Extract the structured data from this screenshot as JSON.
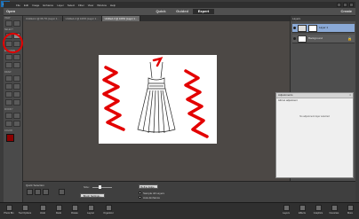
{
  "app": {
    "logo_text": "Ps",
    "menu": [
      "File",
      "Edit",
      "Image",
      "Enhance",
      "Layer",
      "Select",
      "Filter",
      "View",
      "Window",
      "Help"
    ],
    "open_label": "Open",
    "create_label": "Create",
    "modes": [
      "Quick",
      "Guided",
      "Expert"
    ],
    "active_mode": "Expert"
  },
  "document_tabs": [
    {
      "label": "Untitled-1 @ 66.7% (Layer 1...",
      "active": false
    },
    {
      "label": "Untitled-2 @ 100% (Layer 1...",
      "active": false
    },
    {
      "label": "Untitled-3 @ 100% (Layer 1...",
      "active": true
    }
  ],
  "toolbox": {
    "sections": [
      "VIEW",
      "SELECT",
      "ENHANCE",
      "DRAW",
      "MODIFY",
      "COLOR"
    ]
  },
  "layers_panel": {
    "header": "Layers",
    "layers": [
      {
        "name": "Layer 1",
        "active": true
      },
      {
        "name": "Background",
        "active": false
      }
    ]
  },
  "adjustments_panel": {
    "title": "Adjustments",
    "subtitle": "Add an adjustment",
    "empty_text": "No adjustment layer selected"
  },
  "options_bar": {
    "tool_name": "Quick Selection",
    "size_label": "Size:",
    "refine_edge_label": "Refine Edge...",
    "brush_settings_label": "Brush Settings...",
    "sample_all_layers_label": "Sample All Layers",
    "auto_enhance_label": "Auto-Enhance"
  },
  "taskbar": {
    "left_items": [
      "Photo Bin",
      "Tool Options",
      "Undo",
      "Redo",
      "Rotate",
      "Layout",
      "Organizer"
    ],
    "right_items": [
      "Layers",
      "Effects",
      "Graphics",
      "Favorites",
      "More"
    ]
  },
  "colors": {
    "annotation_red": "#e30000",
    "active_tab_bg": "#2c2c2c",
    "layer_selected": "#8aa9d6",
    "canvas_bg": "#4c4845"
  }
}
